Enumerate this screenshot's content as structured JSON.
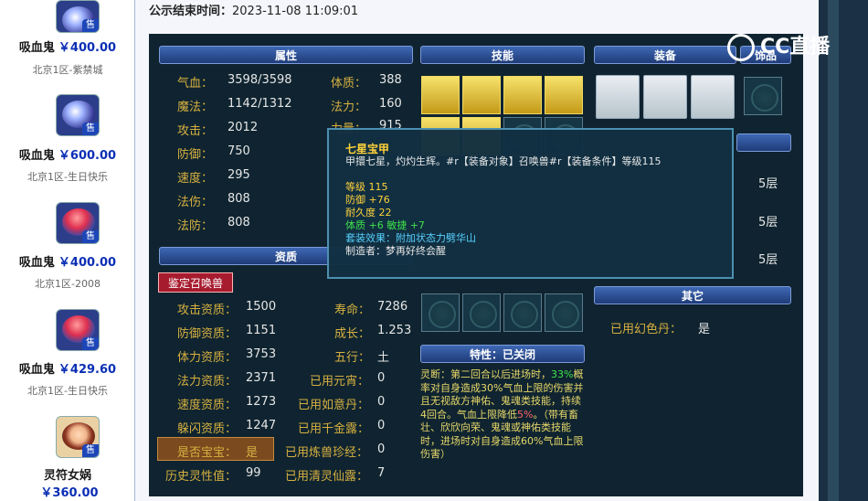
{
  "listings": [
    {
      "pet": "吸血鬼",
      "price": "￥400.00",
      "server": "北京1区-紫禁城",
      "tag": "售"
    },
    {
      "pet": "吸血鬼",
      "price": "￥600.00",
      "server": "北京1区-生日快乐",
      "tag": "售"
    },
    {
      "pet": "吸血鬼",
      "price": "￥400.00",
      "server": "北京1区-2008",
      "tag": "售"
    },
    {
      "pet": "吸血鬼",
      "price": "￥429.60",
      "server": "北京1区-生日快乐",
      "tag": "售"
    },
    {
      "pet": "灵符女娲",
      "price": "￥360.00",
      "server": "",
      "tag": "售"
    }
  ],
  "public_time": {
    "label": "公示结束时间：",
    "value": "2023-11-08 11:09:01"
  },
  "headers": {
    "attributes": "属性",
    "skills": "技能",
    "equipment": "装备",
    "decor": "饰品",
    "aptitude": "资质",
    "other": "其它",
    "trait": "特性：已关闭"
  },
  "attributes_left": [
    {
      "k": "气血：",
      "v": "3598/3598"
    },
    {
      "k": "魔法：",
      "v": "1142/1312"
    },
    {
      "k": "攻击：",
      "v": "2012"
    },
    {
      "k": "防御：",
      "v": "750"
    },
    {
      "k": "速度：",
      "v": "295"
    },
    {
      "k": "法伤：",
      "v": "808"
    },
    {
      "k": "法防：",
      "v": "808"
    }
  ],
  "attributes_right": [
    {
      "k": "体质：",
      "v": "388"
    },
    {
      "k": "法力：",
      "v": "160"
    },
    {
      "k": "力量：",
      "v": "915"
    }
  ],
  "appraise_button": "鉴定召唤兽",
  "aptitude_left": [
    {
      "k": "攻击资质：",
      "v": "1500"
    },
    {
      "k": "防御资质：",
      "v": "1151"
    },
    {
      "k": "体力资质：",
      "v": "3753"
    },
    {
      "k": "法力资质：",
      "v": "2371"
    },
    {
      "k": "速度资质：",
      "v": "1273"
    },
    {
      "k": "躲闪资质：",
      "v": "1247"
    },
    {
      "k": "是否宝宝：",
      "v": "是"
    },
    {
      "k": "历史灵性值：",
      "v": "99"
    }
  ],
  "aptitude_right": [
    {
      "k": "寿命：",
      "v": "7286"
    },
    {
      "k": "成长：",
      "v": "1.253"
    },
    {
      "k": "五行：",
      "v": "土"
    },
    {
      "k": "已用元宵：",
      "v": "0"
    },
    {
      "k": "已用如意丹：",
      "v": "0"
    },
    {
      "k": "已用千金露：",
      "v": "0"
    },
    {
      "k": "已用炼兽珍经：",
      "v": "0"
    },
    {
      "k": "已用清灵仙露：",
      "v": "7"
    }
  ],
  "layers": [
    "5层",
    "5层",
    "5层"
  ],
  "other_row": {
    "k": "已用幻色丹：",
    "v": "是"
  },
  "tooltip": {
    "title": "七星宝甲",
    "desc": "甲擐七星，灼灼生辉。#r【装备对象】召唤兽#r【装备条件】等级115",
    "level": "等级 115",
    "defense": "防御 +76",
    "durability": "耐久度 22",
    "bonus": "体质 +6 敏捷 +7",
    "set_effect": "套装效果：附加状态力劈华山",
    "maker": "制造者：梦再好终会醒"
  },
  "skill_desc": {
    "p1": "灵断：第二回合以后进场时，",
    "p1_g": "33%",
    "p2": "概率对自身造成30%气血上限的伤害并且无视敌方神佑、鬼魂类技能，持续4回合。气血上限降低",
    "p2_r": "5%",
    "p3": "。（带有畜壮、欣欣向荣、鬼魂或神佑类技能时，进场时对自身造成60%气血上限伤害）"
  },
  "logo_text": "CC直播",
  "colors": {
    "panel": "#0f2430",
    "key": "#d7b040",
    "price": "#0b2fb5"
  }
}
